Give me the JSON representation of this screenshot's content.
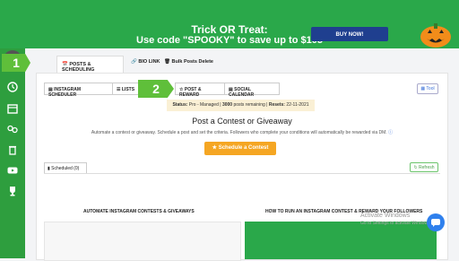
{
  "banner": {
    "line1": "Trick OR Treat:",
    "line2": "Use code \"SPOOKY\" to save up to $105",
    "buy_label": "BUY NOW!",
    "accent": "#2aa84a"
  },
  "sidebar": {
    "icons": [
      "history-icon",
      "calendar-icon",
      "link-icon",
      "trash-icon",
      "youtube-icon",
      "trophy-icon"
    ]
  },
  "topnav": {
    "posts_label": "POSTS & SCHEDULING",
    "bio_label": "BIO LINK",
    "bulk_label": "Bulk Posts Delete"
  },
  "badges": {
    "one": "1",
    "two": "2"
  },
  "tabs": {
    "instagram": "INSTAGRAM SCHEDULER",
    "list": "LISTS",
    "post_reward": "POST & REWARD",
    "social_calendar": "SOCIAL CALENDAR",
    "tool_label": "Tool"
  },
  "status": {
    "prefix": "Status:",
    "plan": "Pro - Managed |",
    "posts": "3000",
    "posts_suffix": "posts remaining |",
    "resets_label": "Resets:",
    "resets_date": "22-11-2021"
  },
  "main": {
    "title": "Post a Contest or Giveaway",
    "desc": "Automate a contest or giveaway. Schedule a post and set the criteria. Followers who complete your conditions will automatically be rewarded via DM.",
    "schedule_label": "Schedule a Contest",
    "scheduled_label": "Scheduled (0)",
    "refresh_label": "Refresh"
  },
  "videos": {
    "left_title": "AUTOMATE INSTAGRAM CONTESTS & GIVEAWAYS",
    "right_title": "HOW TO RUN AN INSTAGRAM CONTEST & REWARD YOUR FOLLOWERS"
  },
  "watermark": {
    "line1": "Activate Windows",
    "line2": "Go to Settings to activate Windows."
  }
}
